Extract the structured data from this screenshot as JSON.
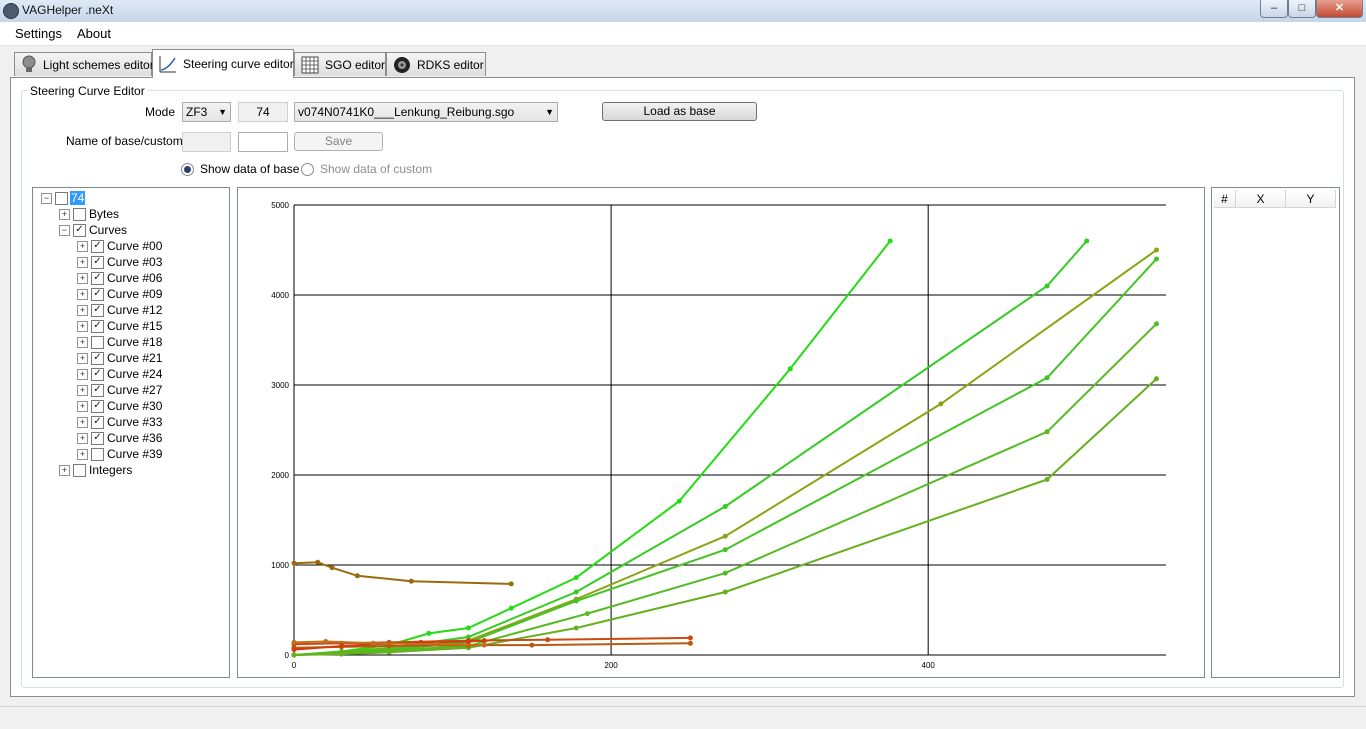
{
  "window": {
    "title": "VAGHelper .neXt",
    "btn_min": "–",
    "btn_max": "□",
    "btn_close": "✕"
  },
  "menu": [
    "Settings",
    "About"
  ],
  "tabs": [
    {
      "label": "Light schemes editor",
      "icon": "lightbulb-icon"
    },
    {
      "label": "Steering curve editor",
      "icon": "curve-chart-icon"
    },
    {
      "label": "SGO editor",
      "icon": "grid-icon"
    },
    {
      "label": "RDKS editor",
      "icon": "tire-icon"
    }
  ],
  "editor": {
    "group_title": "Steering Curve Editor",
    "mode_label": "Mode",
    "mode_value": "ZF3",
    "id_value": "74",
    "file_value": "v074N0741K0___Lenkung_Reibung.sgo",
    "load_button": "Load as base",
    "name_label": "Name of base/custom",
    "save_button": "Save",
    "radio_base": "Show data of base",
    "radio_custom": "Show data of custom"
  },
  "tree": {
    "root": "74",
    "bytes": "Bytes",
    "curves": "Curves",
    "integers": "Integers",
    "curve_items": [
      {
        "label": "Curve #00",
        "checked": true
      },
      {
        "label": "Curve #03",
        "checked": true
      },
      {
        "label": "Curve #06",
        "checked": true
      },
      {
        "label": "Curve #09",
        "checked": true
      },
      {
        "label": "Curve #12",
        "checked": true
      },
      {
        "label": "Curve #15",
        "checked": true
      },
      {
        "label": "Curve #18",
        "checked": false
      },
      {
        "label": "Curve #21",
        "checked": true
      },
      {
        "label": "Curve #24",
        "checked": true
      },
      {
        "label": "Curve #27",
        "checked": true
      },
      {
        "label": "Curve #30",
        "checked": true
      },
      {
        "label": "Curve #33",
        "checked": true
      },
      {
        "label": "Curve #36",
        "checked": true
      },
      {
        "label": "Curve #39",
        "checked": false
      }
    ]
  },
  "table": {
    "col_index": "#",
    "col_x": "X",
    "col_y": "Y"
  },
  "chart_data": {
    "type": "line",
    "xlim": [
      0,
      550
    ],
    "ylim": [
      0,
      5000
    ],
    "x_ticks": [
      0,
      200,
      400
    ],
    "y_ticks": [
      0,
      1000,
      2000,
      3000,
      4000,
      5000
    ],
    "grid": true,
    "series": [
      {
        "color": "#22dd11",
        "x": [
          0,
          30,
          60,
          85,
          110,
          137,
          178,
          243,
          313,
          376
        ],
        "y": [
          0,
          40,
          110,
          240,
          300,
          520,
          860,
          1710,
          3180,
          4600
        ]
      },
      {
        "color": "#33cc22",
        "x": [
          0,
          30,
          60,
          110,
          178,
          272,
          475,
          500
        ],
        "y": [
          0,
          30,
          80,
          200,
          700,
          1650,
          4100,
          4600
        ]
      },
      {
        "color": "#8aa514",
        "x": [
          0,
          30,
          60,
          110,
          178,
          272,
          408,
          544
        ],
        "y": [
          0,
          30,
          70,
          160,
          620,
          1320,
          2790,
          4500
        ]
      },
      {
        "color": "#44c422",
        "x": [
          0,
          30,
          60,
          110,
          178,
          272,
          475,
          544
        ],
        "y": [
          0,
          20,
          60,
          140,
          600,
          1170,
          3080,
          4400
        ]
      },
      {
        "color": "#55bb22",
        "x": [
          0,
          30,
          60,
          110,
          185,
          272,
          475,
          544
        ],
        "y": [
          0,
          20,
          50,
          100,
          460,
          910,
          2480,
          3680
        ]
      },
      {
        "color": "#66b020",
        "x": [
          0,
          30,
          60,
          110,
          178,
          272,
          475,
          544
        ],
        "y": [
          0,
          10,
          30,
          80,
          300,
          700,
          1950,
          3070
        ]
      },
      {
        "color": "#9a6b0c",
        "x": [
          0,
          15,
          24,
          40,
          74,
          137
        ],
        "y": [
          1020,
          1030,
          970,
          880,
          820,
          790
        ]
      },
      {
        "color": "#cc4a10",
        "x": [
          0,
          30,
          60,
          110,
          160,
          250
        ],
        "y": [
          120,
          130,
          140,
          160,
          170,
          190
        ]
      },
      {
        "color": "#b85a12",
        "x": [
          0,
          30,
          60,
          110,
          150,
          250
        ],
        "y": [
          80,
          90,
          100,
          110,
          110,
          130
        ]
      },
      {
        "color": "#d63a10",
        "x": [
          0,
          30,
          50,
          80,
          110,
          120
        ],
        "y": [
          60,
          100,
          120,
          140,
          150,
          160
        ]
      },
      {
        "color": "#c07018",
        "x": [
          0,
          20,
          50,
          90,
          120
        ],
        "y": [
          140,
          150,
          130,
          120,
          110
        ]
      }
    ]
  }
}
